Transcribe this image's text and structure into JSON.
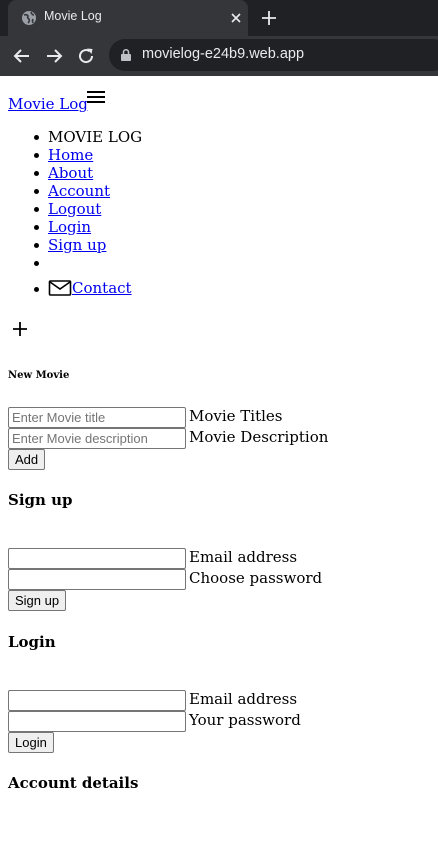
{
  "browser": {
    "tab_title": "Movie Log",
    "url": "movielog-e24b9.web.app"
  },
  "navbar": {
    "brand": "Movie Log",
    "menu": [
      {
        "label": "MOVIE LOG",
        "link": false
      },
      {
        "label": "Home",
        "link": true
      },
      {
        "label": "About",
        "link": true
      },
      {
        "label": "Account",
        "link": true
      },
      {
        "label": "Logout",
        "link": true
      },
      {
        "label": "Login",
        "link": true
      },
      {
        "label": "Sign up",
        "link": true
      },
      {
        "label": "",
        "link": false
      },
      {
        "label": "Contact",
        "link": true,
        "icon": "mail-icon"
      }
    ]
  },
  "new_movie": {
    "heading": "New Movie",
    "title_placeholder": "Enter Movie title",
    "title_label": "Movie Titles",
    "description_placeholder": "Enter Movie description",
    "description_label": "Movie Description",
    "add_button": "Add"
  },
  "signup": {
    "heading": "Sign up",
    "email_label": "Email address",
    "password_label": "Choose password",
    "submit_button": "Sign up"
  },
  "login": {
    "heading": "Login",
    "email_label": "Email address",
    "password_label": "Your password",
    "submit_button": "Login"
  },
  "account": {
    "heading": "Account details"
  },
  "icons": {
    "favicon": "globe-icon",
    "tab_close": "close-icon",
    "new_tab": "plus-icon",
    "back": "arrow-left-icon",
    "forward": "arrow-right-icon",
    "reload": "reload-icon",
    "lock": "lock-icon",
    "menu": "hamburger-icon",
    "add": "plus-icon",
    "contact": "mail-icon"
  },
  "colors": {
    "chrome_dark": "#202124",
    "chrome_tab": "#35363a",
    "link": "#0000ee"
  }
}
